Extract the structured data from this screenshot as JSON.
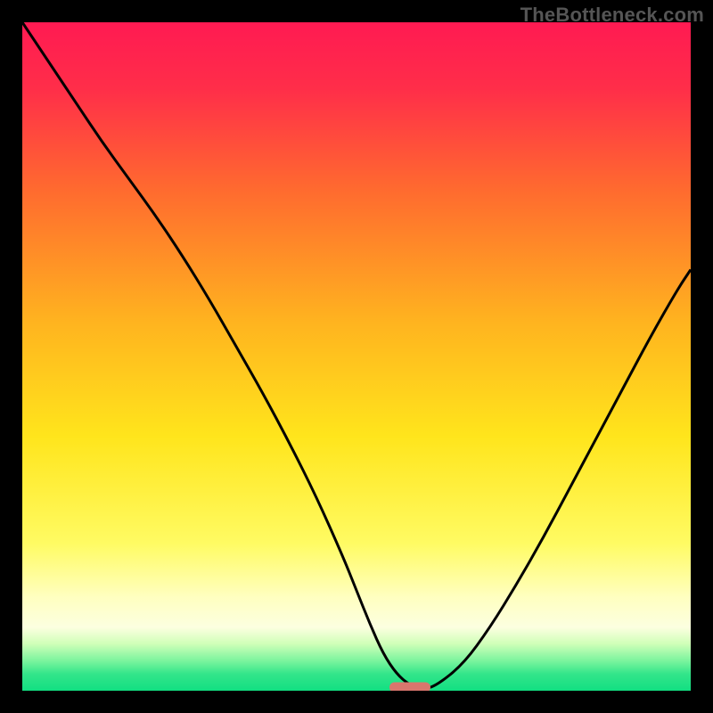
{
  "attribution": "TheBottleneck.com",
  "colors": {
    "gradient_stops": [
      {
        "offset": 0.0,
        "color": "#ff1a52"
      },
      {
        "offset": 0.1,
        "color": "#ff2e49"
      },
      {
        "offset": 0.25,
        "color": "#ff6a2f"
      },
      {
        "offset": 0.45,
        "color": "#ffb41f"
      },
      {
        "offset": 0.62,
        "color": "#ffe51c"
      },
      {
        "offset": 0.78,
        "color": "#fffb63"
      },
      {
        "offset": 0.86,
        "color": "#ffffc0"
      },
      {
        "offset": 0.905,
        "color": "#fcffe0"
      },
      {
        "offset": 0.93,
        "color": "#cfffb8"
      },
      {
        "offset": 0.955,
        "color": "#7cf49e"
      },
      {
        "offset": 0.975,
        "color": "#33e58a"
      },
      {
        "offset": 1.0,
        "color": "#12df82"
      }
    ],
    "curve": "#000000",
    "marker_fill": "#d9766d",
    "marker_stroke": "#d9766d",
    "background": "#000000"
  },
  "chart_data": {
    "type": "line",
    "title": "",
    "xlabel": "",
    "ylabel": "",
    "xlim": [
      0,
      100
    ],
    "ylim": [
      0,
      100
    ],
    "grid": false,
    "legend": false,
    "series": [
      {
        "name": "bottleneck-curve",
        "x": [
          0,
          4,
          8,
          12,
          16,
          20,
          24,
          28,
          32,
          36,
          40,
          44,
          48,
          50,
          52,
          54,
          56,
          58,
          60,
          62,
          66,
          70,
          74,
          78,
          82,
          86,
          90,
          94,
          98,
          100
        ],
        "y": [
          100,
          94,
          88,
          82,
          76.5,
          71,
          65,
          58.5,
          51.5,
          44.5,
          37,
          29,
          20,
          15,
          10,
          5.5,
          2.5,
          0.8,
          0.2,
          0.8,
          4,
          9.5,
          16,
          23,
          30.5,
          38,
          45.5,
          53,
          60,
          63
        ]
      }
    ],
    "marker": {
      "name": "optimal-point",
      "x_center": 58,
      "y": 0.5,
      "width": 6,
      "height": 1.4
    }
  }
}
